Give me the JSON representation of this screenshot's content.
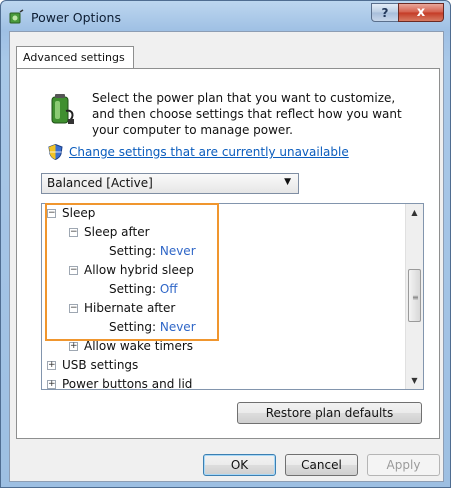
{
  "window": {
    "title": "Power Options"
  },
  "titlebar": {
    "help_label": "?",
    "close_label": "x"
  },
  "tab": {
    "label": "Advanced settings"
  },
  "intro": {
    "text": "Select the power plan that you want to customize, and then choose settings that reflect how you want your computer to manage power."
  },
  "change_link": {
    "text": "Change settings that are currently unavailable"
  },
  "plan_select": {
    "value": "Balanced [Active]"
  },
  "tree": {
    "sleep": "Sleep",
    "sleep_after": "Sleep after",
    "setting_label": "Setting:",
    "sleep_after_value": "Never",
    "hybrid": "Allow hybrid sleep",
    "hybrid_value": "Off",
    "hibernate": "Hibernate after",
    "hibernate_value": "Never",
    "wake_timers": "Allow wake timers",
    "usb": "USB settings",
    "power_buttons": "Power buttons and lid",
    "minus": "−",
    "plus": "+"
  },
  "buttons": {
    "restore": "Restore plan defaults",
    "ok": "OK",
    "cancel": "Cancel",
    "apply": "Apply"
  },
  "colors": {
    "highlight": "#f0962e",
    "link": "#0a5cbd",
    "value": "#2f66c7"
  }
}
